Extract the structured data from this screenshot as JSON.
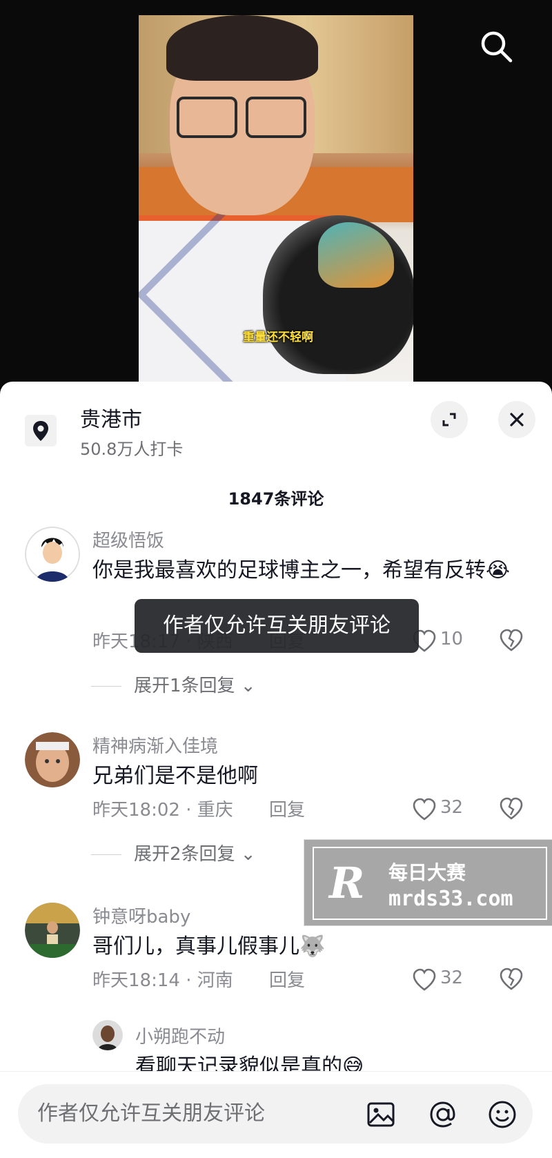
{
  "video": {
    "caption": "重量还不轻啊"
  },
  "icons": {
    "search": "search-icon",
    "location": "location-pin-icon",
    "expand": "expand-icon",
    "close": "close-icon",
    "heart": "heart-icon",
    "dislike": "broken-heart-icon",
    "image": "image-icon",
    "mention": "at-icon",
    "emoji": "emoji-icon"
  },
  "location": {
    "title": "贵港市",
    "subtitle": "50.8万人打卡"
  },
  "comments_header": {
    "count": "1847条评论"
  },
  "comments": [
    {
      "user": "超级悟饭",
      "text": "你是我最喜欢的足球博主之一，希望有反转😭",
      "time": "昨天18:17",
      "region": "陕西",
      "reply_label": "回复",
      "likes": "10",
      "expand": "展开1条回复"
    },
    {
      "user": "精神病渐入佳境",
      "text": "兄弟们是不是他啊",
      "time": "昨天18:02",
      "region": "重庆",
      "reply_label": "回复",
      "likes": "32",
      "expand": "展开2条回复"
    },
    {
      "user": "钟意呀baby",
      "text": "哥们儿，真事儿假事儿🐺",
      "time": "昨天18:14",
      "region": "河南",
      "reply_label": "回复",
      "likes": "32"
    }
  ],
  "sub_reply": {
    "user": "小朔跑不动",
    "text": "看聊天记录貌似是真的😅"
  },
  "toast": {
    "text": "作者仅允许互关朋友评论"
  },
  "watermark": {
    "logo": "R",
    "title": "每日大赛",
    "url": "mrds33.com"
  },
  "bottom_bar": {
    "placeholder": "作者仅允许互关朋友评论"
  },
  "colors": {
    "sheet_bg": "#ffffff",
    "text_primary": "#161823",
    "text_secondary": "#8a8b91",
    "caption": "#ffe03c",
    "toast_bg": "#26272c"
  }
}
